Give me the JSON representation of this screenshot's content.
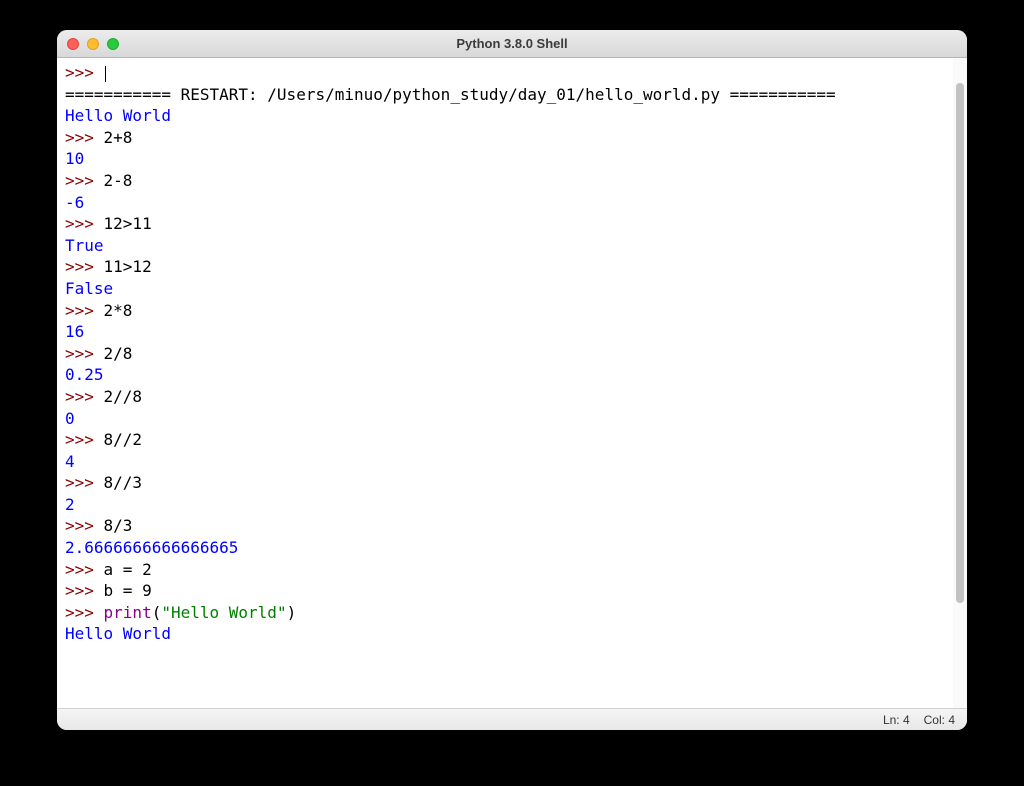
{
  "window": {
    "title": "Python 3.8.0 Shell"
  },
  "shell": {
    "prompt": ">>> ",
    "restart_line": "=========== RESTART: /Users/minuo/python_study/day_01/hello_world.py ===========",
    "lines": [
      {
        "type": "output",
        "text": "Hello World"
      },
      {
        "type": "input",
        "text": "2+8"
      },
      {
        "type": "output",
        "text": "10"
      },
      {
        "type": "input",
        "text": "2-8"
      },
      {
        "type": "output",
        "text": "-6"
      },
      {
        "type": "input",
        "text": "12>11"
      },
      {
        "type": "output",
        "text": "True"
      },
      {
        "type": "input",
        "text": "11>12"
      },
      {
        "type": "output",
        "text": "False"
      },
      {
        "type": "input",
        "text": "2*8"
      },
      {
        "type": "output",
        "text": "16"
      },
      {
        "type": "input",
        "text": "2/8"
      },
      {
        "type": "output",
        "text": "0.25"
      },
      {
        "type": "input",
        "text": "2//8"
      },
      {
        "type": "output",
        "text": "0"
      },
      {
        "type": "input",
        "text": "8//2"
      },
      {
        "type": "output",
        "text": "4"
      },
      {
        "type": "input",
        "text": "8//3"
      },
      {
        "type": "output",
        "text": "2"
      },
      {
        "type": "input",
        "text": "8/3"
      },
      {
        "type": "output",
        "text": "2.6666666666666665"
      },
      {
        "type": "input",
        "text": "a = 2"
      },
      {
        "type": "input",
        "text": "b = 9"
      }
    ],
    "print_call": {
      "builtin": "print",
      "paren_open": "(",
      "string": "\"Hello World\"",
      "paren_close": ")"
    },
    "print_output": "Hello World"
  },
  "status": {
    "ln": "Ln: 4",
    "col": "Col: 4"
  }
}
